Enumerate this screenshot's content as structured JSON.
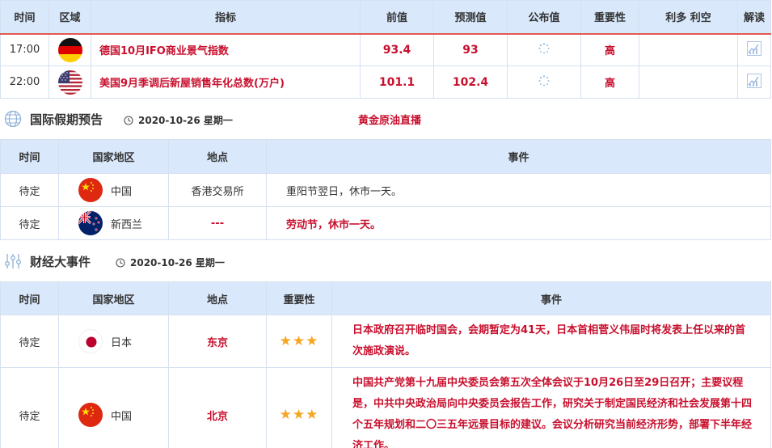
{
  "econ": {
    "headers": [
      "时间",
      "区域",
      "指标",
      "前值",
      "预测值",
      "公布值",
      "重要性",
      "利多 利空",
      "解读"
    ],
    "rows": [
      {
        "time": "17:00",
        "flag": "germany-flag",
        "indicator": "德国10月IFO商业景气指数",
        "prev": "93.4",
        "forecast": "93",
        "actual": "",
        "importance": "高",
        "impact": "",
        "read_icon": "chart-icon"
      },
      {
        "time": "22:00",
        "flag": "usa-flag",
        "indicator": "美国9月季调后新屋销售年化总数(万户)",
        "prev": "101.1",
        "forecast": "102.4",
        "actual": "",
        "importance": "高",
        "impact": "",
        "read_icon": "chart-icon"
      }
    ]
  },
  "holiday": {
    "title": "国际假期预告",
    "date": "2020-10-26 星期一",
    "link": "黄金原油直播",
    "headers": [
      "时间",
      "国家地区",
      "地点",
      "事件"
    ],
    "rows": [
      {
        "time": "待定",
        "country": "中国",
        "place": "香港交易所",
        "event": "重阳节翌日，休市一天。"
      },
      {
        "time": "待定",
        "country": "新西兰",
        "place": "---",
        "event": "劳动节，休市一天。"
      }
    ]
  },
  "events": {
    "title": "财经大事件",
    "date": "2020-10-26 星期一",
    "headers": [
      "时间",
      "国家地区",
      "地点",
      "重要性",
      "事件"
    ],
    "rows": [
      {
        "time": "待定",
        "country": "日本",
        "place": "东京",
        "stars": "★★★",
        "event": "日本政府召开临时国会，会期暂定为41天，日本首相菅义伟届时将发表上任以来的首次施政演说。"
      },
      {
        "time": "待定",
        "country": "中国",
        "place": "北京",
        "stars": "★★★",
        "event": "中国共产党第十九届中央委员会第五次全体会议于10月26日至29日召开；主要议程是，中共中央政治局向中央委员会报告工作，研究关于制定国民经济和社会发展第十四个五年规划和二〇三五年远景目标的建议。会议分析研究当前经济形势，部署下半年经济工作。"
      }
    ]
  },
  "colors": {
    "accent_red": "#c8102e",
    "header_bg": "#d9e8fb",
    "border": "#d6e0f0",
    "star": "#f5a623"
  }
}
